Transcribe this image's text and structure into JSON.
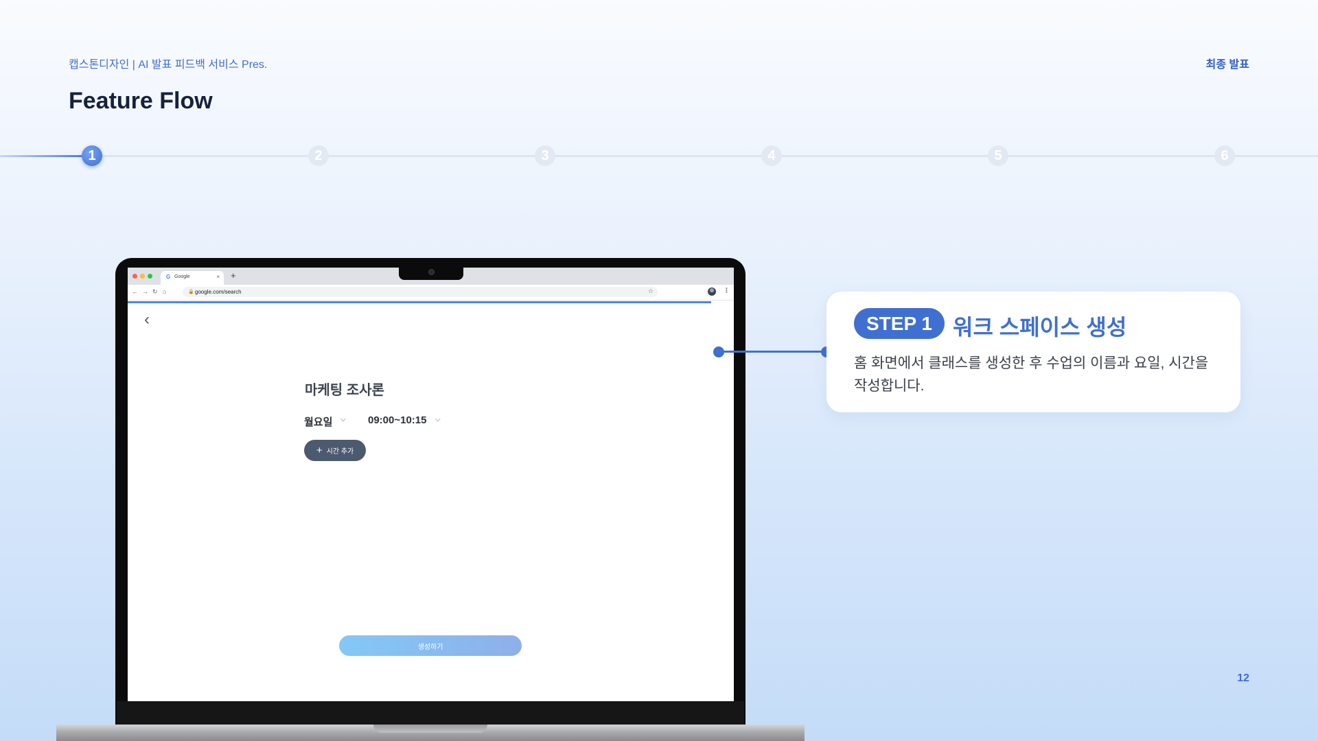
{
  "header": {
    "left_text": "캡스톤디자인 | AI 발표 피드백 서비스 Pres.",
    "right_text": "최종 발표"
  },
  "slide": {
    "title": "Feature Flow",
    "page_number": "12"
  },
  "progress": {
    "steps": [
      "1",
      "2",
      "3",
      "4",
      "5",
      "6"
    ],
    "active_step": 1
  },
  "browser": {
    "tab_title": "Google",
    "tab_favicon": "G",
    "url": "google.com/search",
    "icons": {
      "back": "←",
      "forward": "→",
      "reload": "↻",
      "home": "⌂",
      "lock": "🔒",
      "star": "☆",
      "menu": "⋮",
      "close": "×",
      "new_tab": "+"
    }
  },
  "app": {
    "back_glyph": "‹",
    "class_name": "마케팅 조사론",
    "day": "월요일",
    "time": "09:00~10:15",
    "chevron": "⌵",
    "add_time_label": "시간 추가",
    "plus_glyph": "+",
    "create_label": "생성하기"
  },
  "callout": {
    "badge": "STEP 1",
    "heading": "워크 스페이스 생성",
    "description": "홈 화면에서 클래스를 생성한 후 수업의 이름과 요일, 시간을 작성합니다."
  },
  "colors": {
    "accent": "#3f6fd0",
    "track": "#dde5f1",
    "button_dark": "#4c5a70",
    "button_gradient": [
      "#83c8f6",
      "#8eb0e9"
    ]
  }
}
